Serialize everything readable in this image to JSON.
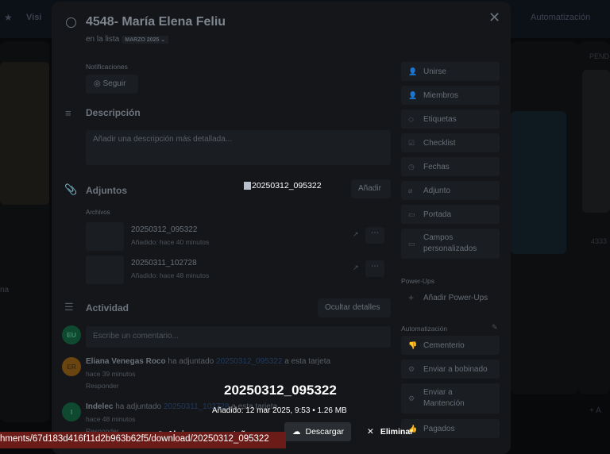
{
  "board": {
    "visibility": "Visi",
    "automation": "Automatización",
    "list_right": "PEND",
    "card_right_num": "4333",
    "card_left_text": "na",
    "add_card": "+ A"
  },
  "card": {
    "title": "4548- María Elena Feliu",
    "in_list": "en la lista",
    "list_name": "MARZO 2025",
    "notifications_label": "Notificaciones",
    "follow": "Seguir",
    "description_heading": "Descripción",
    "description_placeholder": "Añadir una descripción más detallada...",
    "attachments_heading": "Adjuntos",
    "add_button": "Añadir",
    "files_label": "Archivos",
    "files": [
      {
        "name": "20250312_095322",
        "meta": "Añadido: hace 40 minutos"
      },
      {
        "name": "20250311_102728",
        "meta": "Añadido: hace 48 minutos"
      }
    ],
    "activity_heading": "Actividad",
    "hide_details": "Ocultar detalles",
    "comment_placeholder": "Escribe un comentario...",
    "current_user": "EU",
    "activity": [
      {
        "initials": "ER",
        "user": "Eliana Venegas Roco",
        "action": "ha adjuntado",
        "link": "20250312_095322",
        "suffix": "a esta tarjeta",
        "time": "hace 39 minutos",
        "reply": "Responder",
        "color": "#6b4510"
      },
      {
        "initials": "I",
        "user": "Indelec",
        "action": "ha adjuntado",
        "link": "20250311_102728",
        "suffix": "a esta tarjeta",
        "time": "hace 48 minutos",
        "reply": "Responder",
        "color": "#0f4a30"
      }
    ]
  },
  "sidebar": {
    "actions": [
      "Unirse",
      "Miembros",
      "Etiquetas",
      "Checklist",
      "Fechas",
      "Adjunto",
      "Portada",
      "Campos personalizados"
    ],
    "powerups_label": "Power-Ups",
    "add_powerups": "Añadir Power-Ups",
    "automation_label": "Automatización",
    "automations": [
      "Cementerio",
      "Enviar a bobinado",
      "Enviar a Mantención",
      "Pagados"
    ]
  },
  "preview": {
    "broken_image_alt": "20250312_095322",
    "title": "20250312_095322",
    "meta": "Añadido: 12 mar 2025, 9:53 • 1.26 MB",
    "open_new_tab": "Abrir en una pestaña nueva",
    "download": "Descargar",
    "delete": "Eliminar"
  },
  "status_url": "hments/67d183d416f11d2b963b62f5/download/20250312_095322"
}
